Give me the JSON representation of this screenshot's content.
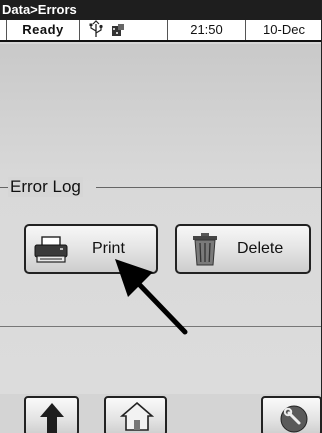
{
  "window": {
    "title": "Data>Errors"
  },
  "status": {
    "state": "Ready",
    "icons": [
      "usb-icon",
      "device-icon"
    ],
    "time": "21:50",
    "date": "10-Dec"
  },
  "error_log": {
    "group_label": "Error Log",
    "print_label": "Print",
    "delete_label": "Delete"
  },
  "nav": {
    "icons": [
      "up-arrow-icon",
      "home-icon",
      "tools-icon"
    ]
  },
  "colors": {
    "background": "#d6d6d6",
    "titlebar": "#1e1e1e"
  }
}
